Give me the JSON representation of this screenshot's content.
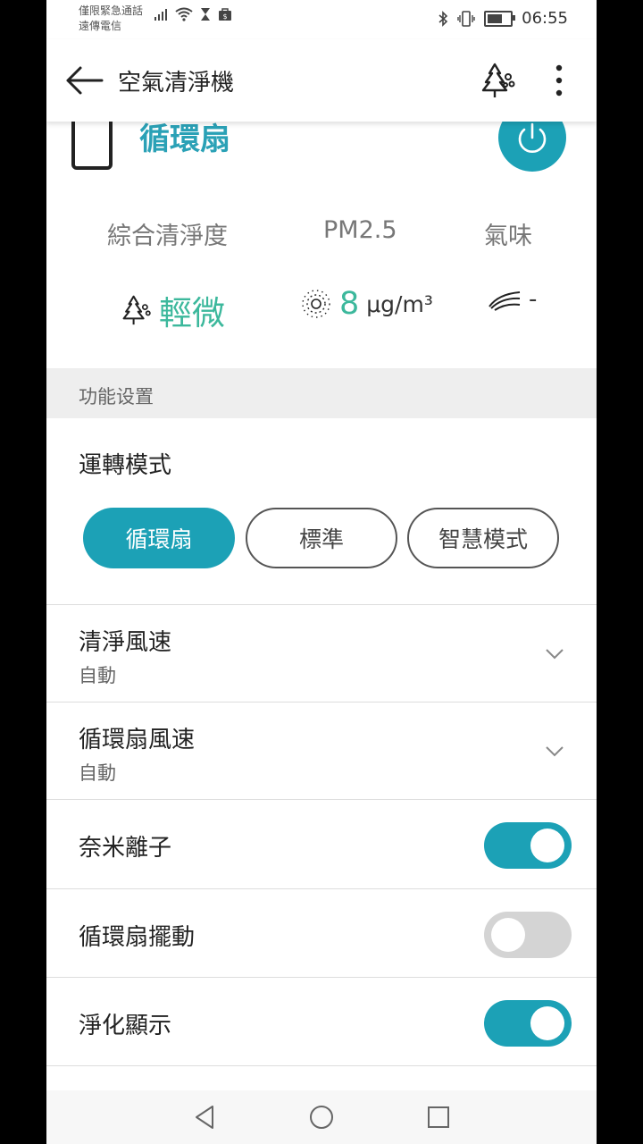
{
  "status_bar": {
    "carrier_line1": "僅限緊急通話",
    "carrier_line2": "遠傳電信",
    "time": "06:55",
    "battery_level": 0.8
  },
  "app_bar": {
    "title": "空氣清淨機"
  },
  "device": {
    "mode_name": "循環扇",
    "accent_color": "#1ca1b6"
  },
  "air_quality": {
    "overall_label": "綜合清淨度",
    "overall_value": "輕微",
    "pm_label": "PM2.5",
    "pm_value": "8",
    "pm_unit": "μg/m³",
    "odor_label": "氣味",
    "odor_value": "-"
  },
  "section": {
    "title": "功能设置"
  },
  "mode": {
    "title": "運轉模式",
    "options": [
      {
        "label": "循環扇",
        "selected": true
      },
      {
        "label": "標準",
        "selected": false
      },
      {
        "label": "智慧模式",
        "selected": false
      }
    ]
  },
  "settings": {
    "clean_speed": {
      "title": "清淨風速",
      "value": "自動"
    },
    "fan_speed": {
      "title": "循環扇風速",
      "value": "自動"
    },
    "nano_ion": {
      "title": "奈米離子",
      "on": true
    },
    "fan_swing": {
      "title": "循環扇擺動",
      "on": false
    },
    "display": {
      "title": "淨化顯示",
      "on": true
    }
  }
}
